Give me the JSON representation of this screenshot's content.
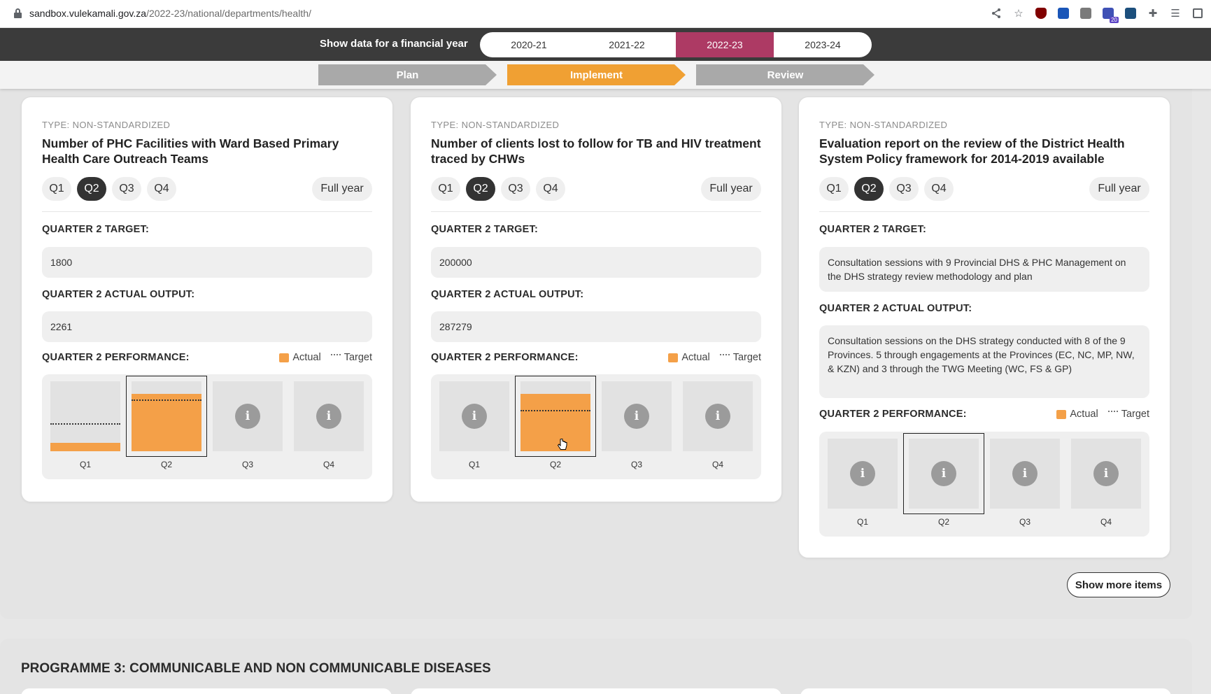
{
  "browser": {
    "url_host": "sandbox.vulekamali.gov.za",
    "url_path": "/2022-23/national/departments/health/",
    "extension_badge": "20"
  },
  "yearbar": {
    "label": "Show data for a financial year",
    "years": [
      "2020-21",
      "2021-22",
      "2022-23",
      "2023-24"
    ],
    "selected": "2022-23"
  },
  "phases": [
    "Plan",
    "Implement",
    "Review"
  ],
  "selected_phase": "Implement",
  "colors": {
    "actual": "#f4a048",
    "year_active": "#ad3a64",
    "phase_active": "#f0a033",
    "phase_inactive": "#a9a9a9"
  },
  "cards": [
    {
      "type": "TYPE: NON-STANDARDIZED",
      "title": "Number of PHC Facilities with Ward Based Primary Health Care Outreach Teams",
      "quarters": [
        "Q1",
        "Q2",
        "Q3",
        "Q4"
      ],
      "selected_quarter": "Q2",
      "full_year": "Full year",
      "target_label": "QUARTER 2 TARGET:",
      "target_value": "1800",
      "actual_label": "QUARTER 2 ACTUAL OUTPUT:",
      "actual_value": "2261",
      "performance_label": "QUARTER 2 PERFORMANCE:",
      "legend_actual": "Actual",
      "legend_target": "Target",
      "chart": [
        {
          "q": "Q1",
          "actual_level": 0.12,
          "target_level": 0.38,
          "info": false
        },
        {
          "q": "Q2",
          "actual_level": 0.82,
          "target_level": 0.72,
          "info": false
        },
        {
          "q": "Q3",
          "info": true
        },
        {
          "q": "Q4",
          "info": true
        }
      ]
    },
    {
      "type": "TYPE: NON-STANDARDIZED",
      "title": "Number of clients lost to follow for TB and HIV treatment traced by CHWs",
      "quarters": [
        "Q1",
        "Q2",
        "Q3",
        "Q4"
      ],
      "selected_quarter": "Q2",
      "full_year": "Full year",
      "target_label": "QUARTER 2 TARGET:",
      "target_value": "200000",
      "actual_label": "QUARTER 2 ACTUAL OUTPUT:",
      "actual_value": "287279",
      "performance_label": "QUARTER 2 PERFORMANCE:",
      "legend_actual": "Actual",
      "legend_target": "Target",
      "chart": [
        {
          "q": "Q1",
          "info": true
        },
        {
          "q": "Q2",
          "actual_level": 0.82,
          "target_level": 0.57,
          "info": false
        },
        {
          "q": "Q3",
          "info": true
        },
        {
          "q": "Q4",
          "info": true
        }
      ]
    },
    {
      "type": "TYPE: NON-STANDARDIZED",
      "title": "Evaluation report on the review of the District Health System Policy framework for 2014-2019 available",
      "quarters": [
        "Q1",
        "Q2",
        "Q3",
        "Q4"
      ],
      "selected_quarter": "Q2",
      "full_year": "Full year",
      "target_label": "QUARTER 2 TARGET:",
      "target_value": "Consultation sessions with 9 Provincial DHS & PHC Management on the DHS strategy review methodology and plan",
      "actual_label": "QUARTER 2 ACTUAL OUTPUT:",
      "actual_value": "Consultation sessions on the DHS strategy conducted with 8 of the 9 Provinces. 5 through engagements at the Provinces (EC, NC, MP, NW, & KZN) and 3 through the TWG Meeting (WC, FS & GP)",
      "performance_label": "QUARTER 2 PERFORMANCE:",
      "legend_actual": "Actual",
      "legend_target": "Target",
      "chart": [
        {
          "q": "Q1",
          "info": true
        },
        {
          "q": "Q2",
          "info": true
        },
        {
          "q": "Q3",
          "info": true
        },
        {
          "q": "Q4",
          "info": true
        }
      ]
    }
  ],
  "show_more": "Show more items",
  "programme_title": "PROGRAMME 3: COMMUNICABLE AND NON COMMUNICABLE DISEASES"
}
